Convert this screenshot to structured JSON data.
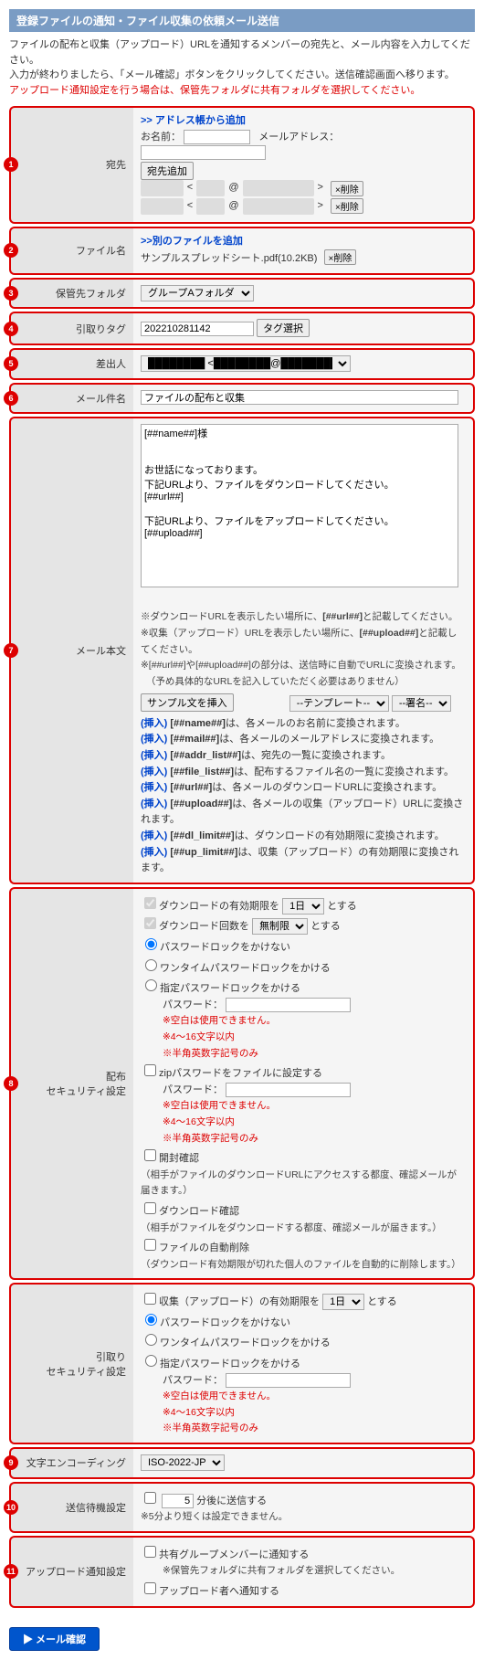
{
  "header": "登録ファイルの通知・ファイル収集の依頼メール送信",
  "intro": {
    "l1": "ファイルの配布と収集（アップロード）URLを通知するメンバーの宛先と、メール内容を入力してください。",
    "l2": "入力が終わりましたら、「メール確認」ボタンをクリックしてください。送信確認画面へ移ります。",
    "warn": "アップロード通知設定を行う場合は、保管先フォルダに共有フォルダを選択してください。"
  },
  "labels": {
    "to": "宛先",
    "file": "ファイル名",
    "folder": "保管先フォルダ",
    "tag": "引取りタグ",
    "sender": "差出人",
    "subject": "メール件名",
    "body": "メール本文",
    "distSec": "配布\nセキュリティ設定",
    "pickSec": "引取り\nセキュリティ設定",
    "encoding": "文字エンコーディング",
    "delay": "送信待機設定",
    "upNotify": "アップロード通知設定"
  },
  "to": {
    "addFromBook": ">> アドレス帳から追加",
    "nameLbl": "お名前：",
    "mailLbl": "メールアドレス：",
    "addBtn": "宛先追加",
    "entries": [
      {
        "name": "██████",
        "mid": "████",
        "dom": "██████████",
        "del": "削除"
      },
      {
        "name": "██████",
        "mid": "████",
        "dom": "██████████",
        "del": "削除"
      }
    ]
  },
  "file": {
    "addAnother": ">>別のファイルを追加",
    "name": "サンプルスプレッドシート.pdf(10.2KB)",
    "del": "削除"
  },
  "folder": {
    "selected": "グループAフォルダ"
  },
  "tag": {
    "value": "202210281142",
    "btn": "タグ選択"
  },
  "sender": {
    "mid": "████",
    "dom": "██████████"
  },
  "subject": {
    "value": "ファイルの配布と収集"
  },
  "body": {
    "text": "[##name##]様\n\n\nお世話になっております。\n下記URLより、ファイルをダウンロードしてください。\n[##url##]\n\n下記URLより、ファイルをアップロードしてください。\n[##upload##]",
    "hint1": "※ダウンロードURLを表示したい場所に、[##url##]と記載してください。",
    "hint1b": "[##url##]",
    "hint2a": "※収集（アップロード）URLを表示したい場所に、",
    "hint2b": "[##upload##]",
    "hint2c": "と記載してください。",
    "hint3": "※[##url##]や[##upload##]の部分は、送信時に自動でURLに変換されます。",
    "hint4": "（予め具体的なURLを記入していただく必要はありません）",
    "sampleBtn": "サンプル文を挿入",
    "tplSel": "--テンプレート--",
    "sigSel": "--署名--",
    "inserts": [
      {
        "token": "[##name##]",
        "desc": "は、各メールのお名前に変換されます。"
      },
      {
        "token": "[##mail##]",
        "desc": "は、各メールのメールアドレスに変換されます。"
      },
      {
        "token": "[##addr_list##]",
        "desc": "は、宛先の一覧に変換されます。"
      },
      {
        "token": "[##file_list##]",
        "desc": "は、配布するファイル名の一覧に変換されます。"
      },
      {
        "token": "[##url##]",
        "desc": "は、各メールのダウンロードURLに変換されます。"
      },
      {
        "token": "[##upload##]",
        "desc": "は、各メールの収集（アップロード）URLに変換されます。"
      },
      {
        "token": "[##dl_limit##]",
        "desc": "は、ダウンロードの有効期限に変換されます。"
      },
      {
        "token": "[##up_limit##]",
        "desc": "は、収集（アップロード）の有効期限に変換されます。"
      }
    ],
    "insLabel": "(挿入)"
  },
  "dist": {
    "dlExpirePre": "ダウンロードの有効期限を",
    "dlExpireSel": "1日",
    "dlExpirePost": "とする",
    "dlCountPre": "ダウンロード回数を",
    "dlCountSel": "無制限",
    "dlCountPost": "とする",
    "pwNone": "パスワードロックをかけない",
    "pwOnetime": "ワンタイムパスワードロックをかける",
    "pwFixed": "指定パスワードロックをかける",
    "pwLabel": "パスワード：",
    "pwWarn1": "※空白は使用できません。",
    "pwWarn2": "※4～16文字以内",
    "pwWarn3": "※半角英数字記号のみ",
    "zip": "zipパスワードをファイルに設定する",
    "open": "開封確認",
    "openDesc": "（相手がファイルのダウンロードURLにアクセスする都度、確認メールが届きます。）",
    "dlConf": "ダウンロード確認",
    "dlConfDesc": "（相手がファイルをダウンロードする都度、確認メールが届きます。）",
    "autoDel": "ファイルの自動削除",
    "autoDelDesc": "（ダウンロード有効期限が切れた個人のファイルを自動的に削除します。）"
  },
  "pick": {
    "upExpirePre": "収集（アップロード）の有効期限を",
    "upExpireSel": "1日",
    "upExpirePost": "とする",
    "pwNone": "パスワードロックをかけない",
    "pwOnetime": "ワンタイムパスワードロックをかける",
    "pwFixed": "指定パスワードロックをかける",
    "pwLabel": "パスワード：",
    "pwWarn1": "※空白は使用できません。",
    "pwWarn2": "※4～16文字以内",
    "pwWarn3": "※半角英数字記号のみ"
  },
  "encoding": {
    "selected": "ISO-2022-JP"
  },
  "delay": {
    "val": "5",
    "post": "分後に送信する",
    "note": "※5分より短くは設定できません。"
  },
  "upNotify": {
    "group": "共有グループメンバーに通知する",
    "groupNote": "※保管先フォルダに共有フォルダを選択してください。",
    "uploader": "アップロード者へ通知する"
  },
  "submit": "▶ メール確認"
}
